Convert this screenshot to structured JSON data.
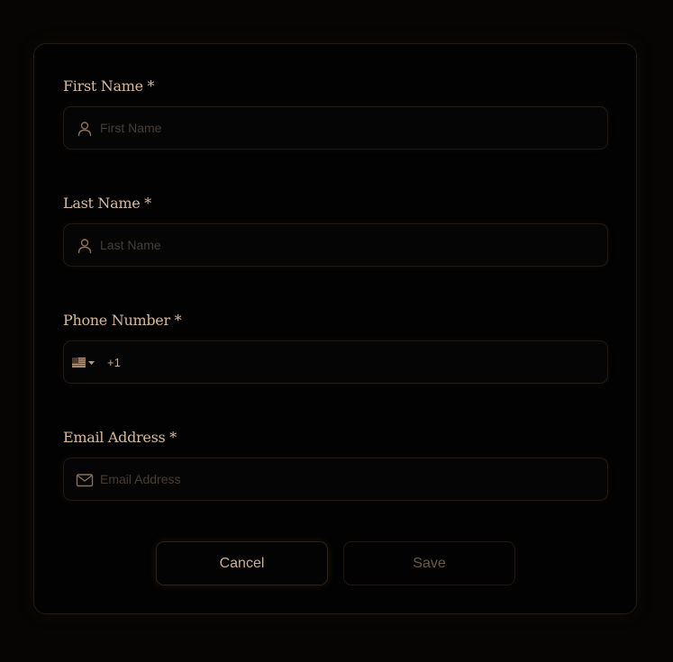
{
  "form": {
    "first_name": {
      "label": "First Name *",
      "placeholder": "First Name",
      "value": "",
      "icon": "user-icon"
    },
    "last_name": {
      "label": "Last Name *",
      "placeholder": "Last Name",
      "value": "",
      "icon": "user-icon"
    },
    "phone": {
      "label": "Phone Number *",
      "country_flag": "us-flag-icon",
      "dial_code": "+1",
      "value": ""
    },
    "email": {
      "label": "Email Address *",
      "placeholder": "Email Address",
      "value": "",
      "icon": "mail-icon"
    }
  },
  "actions": {
    "cancel_label": "Cancel",
    "save_label": "Save"
  },
  "colors": {
    "background": "#060504",
    "card": "#020202",
    "label": "#d8b896",
    "accent": "#c9a684",
    "placeholder": "#4a3c30",
    "border": "#24190f"
  }
}
